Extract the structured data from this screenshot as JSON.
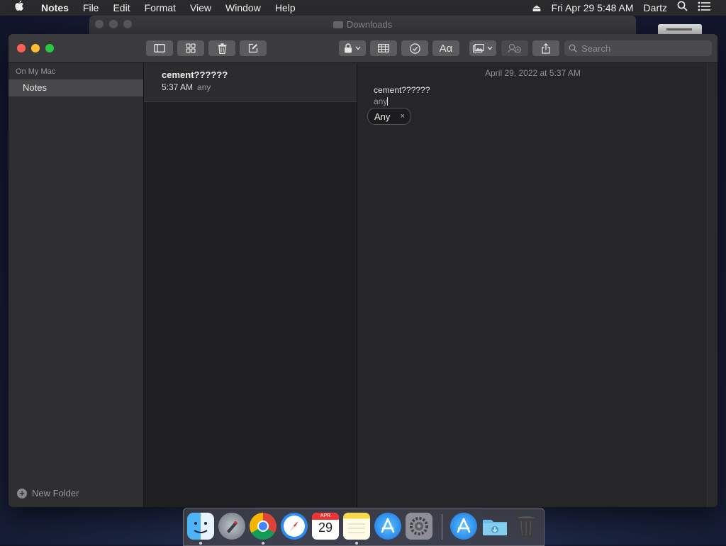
{
  "menubar": {
    "apple": "",
    "app": "Notes",
    "menus": [
      "File",
      "Edit",
      "Format",
      "View",
      "Window",
      "Help"
    ],
    "eject": "⏏",
    "datetime": "Fri Apr 29  5:48 AM",
    "user": "Dartz"
  },
  "background_window": {
    "title": "Downloads"
  },
  "search": {
    "placeholder": "Search"
  },
  "sidebar": {
    "section": "On My Mac",
    "folder": "Notes",
    "new_folder": "New Folder"
  },
  "note_list": {
    "items": [
      {
        "title": "cement??????",
        "time": "5:37 AM",
        "preview": "any"
      }
    ]
  },
  "editor": {
    "date": "April 29, 2022 at 5:37 AM",
    "line1": "cement??????",
    "line2": "any",
    "tag_label": "Any",
    "tag_close": "×"
  },
  "dock": {
    "calendar_month": "APR",
    "calendar_day": "29"
  },
  "colors": {
    "close": "#ff5f57",
    "minimize": "#febc2e",
    "zoom": "#28c840",
    "selection": "#48484a"
  }
}
